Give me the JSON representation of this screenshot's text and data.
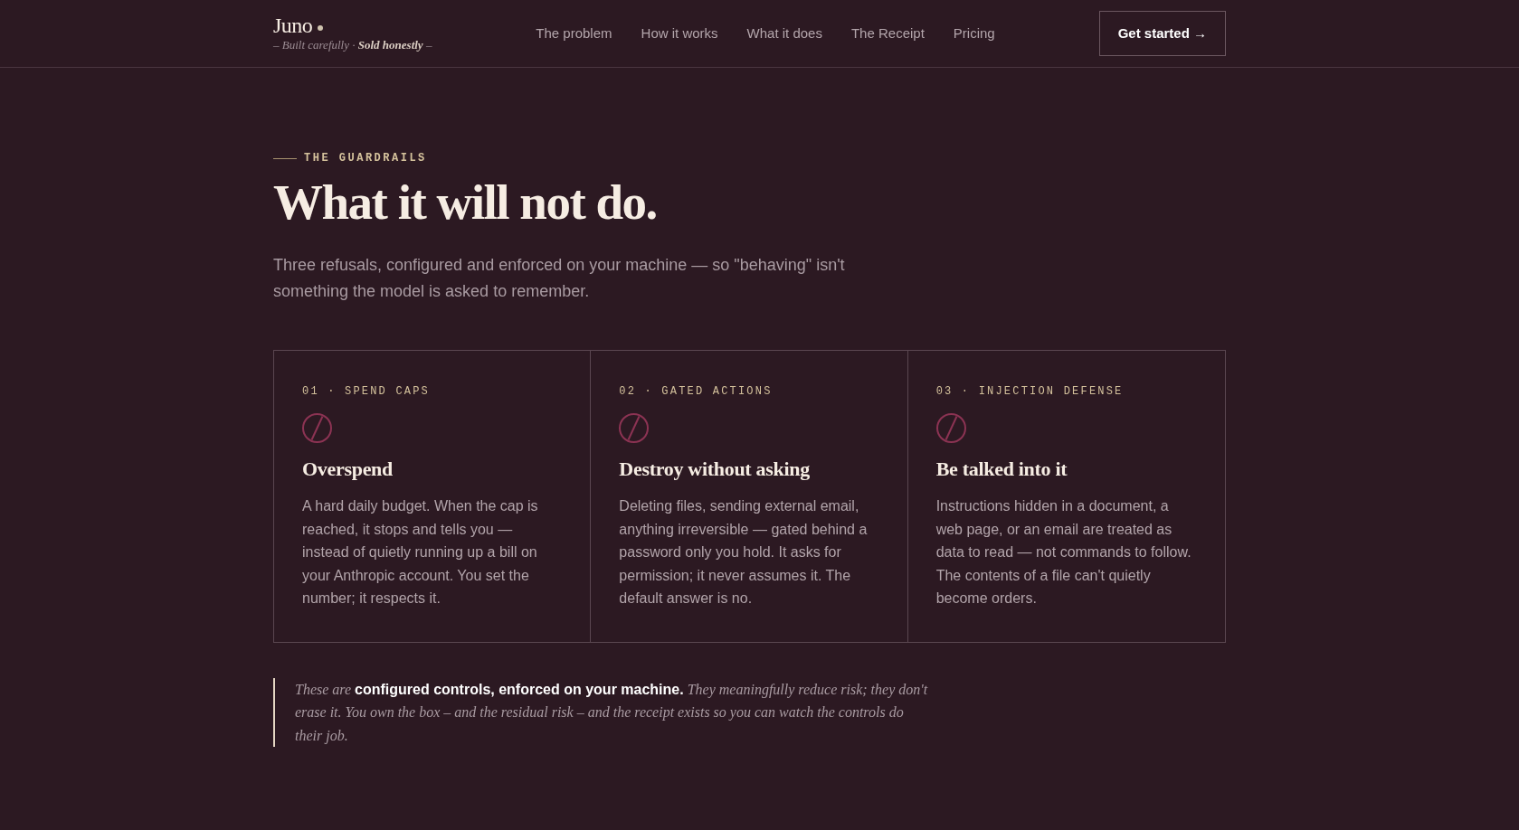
{
  "header": {
    "logo": {
      "name": "Juno",
      "tagline": "– Built carefully · **Sold honestly** –"
    },
    "nav": [
      "The problem",
      "How it works",
      "What it does",
      "The Receipt",
      "Pricing"
    ],
    "cta": {
      "label": "Get started →"
    }
  },
  "section": {
    "eyebrow": "THE GUARDRAILS",
    "title": "What it will not do.",
    "lead": "Three refusals, configured and enforced on your machine — so \"behaving\" isn't something the model is asked to remember.",
    "cards": [
      {
        "label": "01 · SPEND CAPS",
        "title": "Overspend",
        "body": "A hard daily budget. When the cap is reached, it stops and tells you — instead of quietly running up a bill on your Anthropic account. You set the number; it respects it."
      },
      {
        "label": "02 · GATED ACTIONS",
        "title": "Destroy without asking",
        "body": "Deleting files, sending external email, anything irreversible — gated behind a password only you hold. It asks for permission; it never assumes it. The default answer is no."
      },
      {
        "label": "03 · INJECTION DEFENSE",
        "title": "Be talked into it",
        "body": "Instructions hidden in a document, a web page, or an email are treated as data to read — not commands to follow. The contents of a file can't quietly become orders."
      }
    ],
    "note": "These are **configured controls, enforced on your machine.** They meaningfully reduce risk; they don't erase it. You own the box – and the residual risk – and the receipt exists so you can watch the controls do their job."
  }
}
